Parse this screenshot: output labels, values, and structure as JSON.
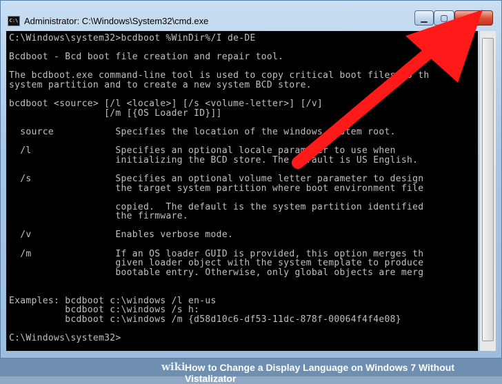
{
  "window": {
    "title": "Administrator: C:\\Windows\\System32\\cmd.exe",
    "icon_label": "C:\\",
    "minimize_glyph": "▁",
    "maximize_glyph": "▢",
    "close_glyph": "X"
  },
  "console": {
    "lines": [
      "C:\\Windows\\system32>bcdboot %WinDir%/I de-DE",
      "",
      "Bcdboot - Bcd boot file creation and repair tool.",
      "",
      "The bcdboot.exe command-line tool is used to copy critical boot files to th",
      "system partition and to create a new system BCD store.",
      "",
      "bcdboot <source> [/l <locale>] [/s <volume-letter>] [/v]",
      "                 [/m [{OS Loader ID}]]",
      "",
      "  source           Specifies the location of the windows system root.",
      "",
      "  /l               Specifies an optional locale parameter to use when",
      "                   initializing the BCD store. The default is US English.",
      "",
      "  /s               Specifies an optional volume letter parameter to design",
      "                   the target system partition where boot environment file",
      "",
      "                   copied.  The default is the system partition identified",
      "                   the firmware.",
      "",
      "  /v               Enables verbose mode.",
      "",
      "  /m               If an OS loader GUID is provided, this option merges th",
      "                   given loader object with the system template to produce",
      "                   bootable entry. Otherwise, only global objects are merg",
      "",
      "",
      "Examples: bcdboot c:\\windows /l en-us",
      "          bcdboot c:\\windows /s h:",
      "          bcdboot c:\\windows /m {d58d10c6-df53-11dc-878f-00064f4f4e08}",
      "",
      "C:\\Windows\\system32>"
    ]
  },
  "footer": {
    "brand": "wiki",
    "caption": "How to Change a Display Language on Windows 7 Without Vistalizator"
  },
  "colors": {
    "arrow": "#ff1a1a",
    "console_bg": "#000000",
    "console_fg": "#c0c0c0"
  }
}
